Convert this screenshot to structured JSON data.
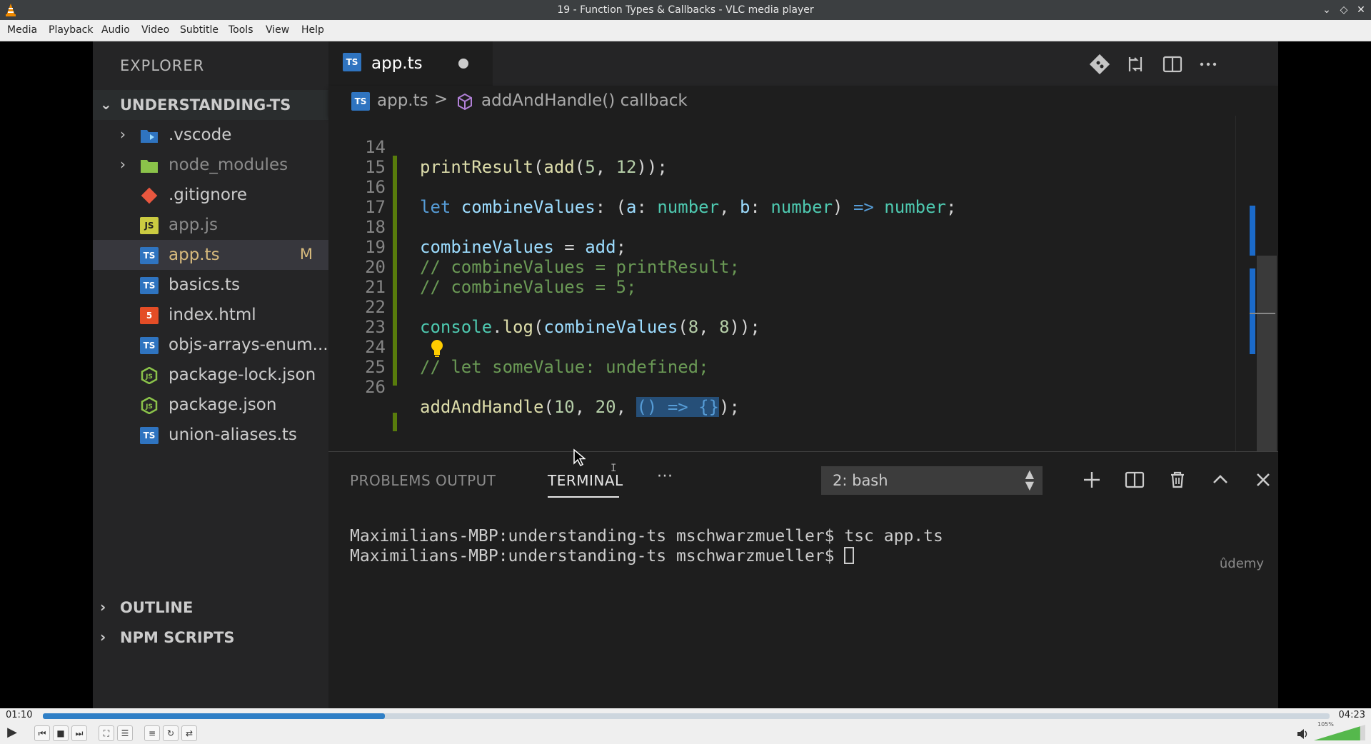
{
  "window": {
    "title": "19 - Function Types & Callbacks - VLC media player"
  },
  "menu": [
    "Media",
    "Playback",
    "Audio",
    "Video",
    "Subtitle",
    "Tools",
    "View",
    "Help"
  ],
  "explorer": {
    "title": "EXPLORER",
    "project": "UNDERSTANDING-TS",
    "items": [
      {
        "name": ".vscode",
        "icon": "vscode-folder-icon",
        "folder": true
      },
      {
        "name": "node_modules",
        "icon": "node-folder-icon",
        "folder": true
      },
      {
        "name": ".gitignore",
        "icon": "git-icon"
      },
      {
        "name": "app.js",
        "icon": "js-file-icon"
      },
      {
        "name": "app.ts",
        "icon": "ts-file-icon",
        "badge": "M",
        "selected": true
      },
      {
        "name": "basics.ts",
        "icon": "ts-file-icon"
      },
      {
        "name": "index.html",
        "icon": "html-file-icon"
      },
      {
        "name": "objs-arrays-enum...",
        "icon": "ts-file-icon"
      },
      {
        "name": "package-lock.json",
        "icon": "node-json-icon"
      },
      {
        "name": "package.json",
        "icon": "node-json-icon"
      },
      {
        "name": "union-aliases.ts",
        "icon": "ts-file-icon"
      }
    ],
    "outline": "OUTLINE",
    "npm_scripts": "NPM SCRIPTS"
  },
  "editor": {
    "tab": {
      "label": "app.ts",
      "icon_text": "TS"
    },
    "breadcrumb": {
      "file": "app.ts",
      "separator": ">",
      "symbol": "addAndHandle() callback"
    },
    "line_numbers": [
      "14",
      "15",
      "16",
      "17",
      "18",
      "19",
      "20",
      "21",
      "22",
      "23",
      "24",
      "25",
      "26"
    ],
    "code": {
      "l14_fn": "printResult",
      "l14_p1": "(",
      "l14_fn2": "add",
      "l14_p2": "(",
      "l14_n1": "5",
      "l14_p3": ", ",
      "l14_n2": "12",
      "l14_p4": "));",
      "l16_kw": "let ",
      "l16_var": "combineValues",
      "l16_p1": ": (",
      "l16_a": "a",
      "l16_p2": ": ",
      "l16_t1": "number",
      "l16_p3": ", ",
      "l16_b": "b",
      "l16_p4": ": ",
      "l16_t2": "number",
      "l16_p5": ") ",
      "l16_arrow": "=>",
      "l16_p6": " ",
      "l16_t3": "number",
      "l16_p7": ";",
      "l18_var": "combineValues",
      "l18_p1": " = ",
      "l18_var2": "add",
      "l18_p2": ";",
      "l19_cmt": "// combineValues = printResult;",
      "l20_cmt": "// combineValues = 5;",
      "l22_obj": "console",
      "l22_p1": ".",
      "l22_fn": "log",
      "l22_p2": "(",
      "l22_fn2": "combineValues",
      "l22_p3": "(",
      "l22_n1": "8",
      "l22_p4": ", ",
      "l22_n2": "8",
      "l22_p5": "));",
      "l24_cmt": "// let someValue: undefined;",
      "l26_fn": "addAndHandle",
      "l26_p1": "(",
      "l26_n1": "10",
      "l26_p2": ", ",
      "l26_n2": "20",
      "l26_p3": ", ",
      "l26_sel": "() => {}",
      "l26_p4": ");"
    }
  },
  "panel": {
    "tabs": [
      "PROBLEMS",
      "OUTPUT",
      "TERMINAL"
    ],
    "active_tab": "TERMINAL",
    "more": "···",
    "terminal_select": "2: bash",
    "terminal_lines": [
      "Maximilians-MBP:understanding-ts mschwarzmueller$ tsc app.ts",
      "Maximilians-MBP:understanding-ts mschwarzmueller$ "
    ],
    "watermark": "ûdemy"
  },
  "player": {
    "time_elapsed": "01:10",
    "time_total": "04:23",
    "progress": 0.266,
    "volume_label": "105%",
    "volume": 1.05
  },
  "colors": {
    "accent": "#2f7fc6",
    "ts_blue": "#2f74c0",
    "modified": "#d7ba7d"
  }
}
